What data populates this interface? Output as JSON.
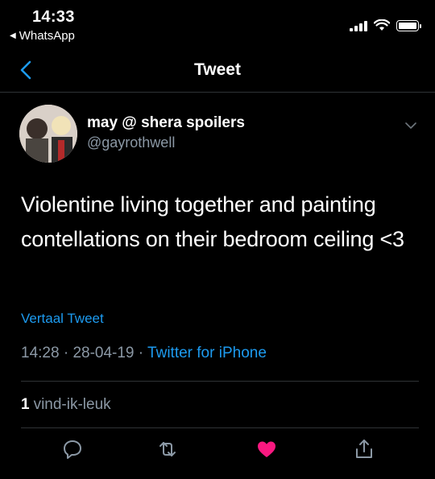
{
  "status_bar": {
    "time": "14:33",
    "back_app": "WhatsApp"
  },
  "nav": {
    "title": "Tweet"
  },
  "tweet": {
    "display_name": "may @ shera spoilers",
    "handle": "@gayrothwell",
    "text": "Violentine living together and painting contellations on their bedroom ceiling <3",
    "translate_link": "Vertaal Tweet",
    "time": "14:28",
    "separator": "·",
    "date": "28-04-19",
    "source": "Twitter for iPhone",
    "likes_count": "1",
    "likes_label": "vind-ik-leuk"
  },
  "actions": [
    "reply-icon",
    "retweet-icon",
    "like-icon",
    "share-icon"
  ],
  "colors": {
    "background": "#000000",
    "accent": "#1d9bf0",
    "secondary_text": "#8b98a5",
    "like": "#f91880"
  }
}
